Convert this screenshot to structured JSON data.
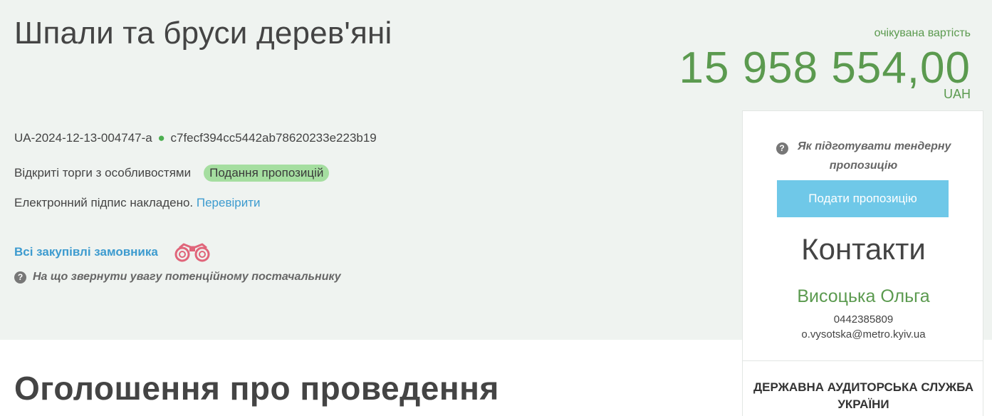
{
  "tender": {
    "title": "Шпали та бруси дерев'яні",
    "expected_label": "очікувана вартість",
    "expected_amount": "15 958 554,00",
    "currency": "UAH",
    "id": "UA-2024-12-13-004747-a",
    "hash": "c7fecf394cc5442ab78620233e223b19",
    "procedure_type": "Відкриті торги з особливостями",
    "status": "Подання пропозицій",
    "signature_text": "Електронний підпис накладено.",
    "signature_check_link": "Перевірити",
    "customer_link": "Всі закупівлі замовника",
    "hint": "На що звернути увагу потенційному постачальнику"
  },
  "section": {
    "title": "Оголошення про проведення"
  },
  "side_panel": {
    "how_to_line1": "Як підготувати тендерну",
    "how_to_line2": "пропозицію",
    "submit_button": "Подати пропозицію",
    "contacts_title": "Контакти",
    "contact_name": "Висоцька Ольга",
    "contact_phone": "0442385809",
    "contact_email": "o.vysotska@metro.kyiv.ua",
    "audit_line1": "ДЕРЖАВНА АУДИТОРСЬКА СЛУЖБА",
    "audit_line2": "УКРАЇНИ"
  },
  "icons": {
    "status_dot": "green-dot",
    "question": "question-circle-icon",
    "binoculars": "binoculars-icon"
  },
  "colors": {
    "accent_green": "#5b9a4f",
    "link_blue": "#3d9bcf",
    "status_badge": "#a5dea0",
    "submit_button": "#6fc8e8",
    "band_background": "#eff3f0"
  }
}
